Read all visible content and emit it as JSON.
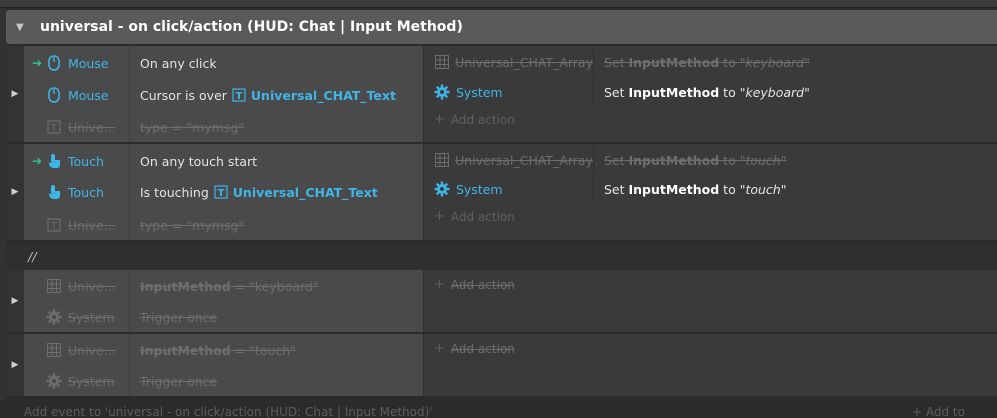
{
  "group": {
    "title": "universal - on click/action (HUD: Chat | Input Method)"
  },
  "events": [
    {
      "conditions": [
        {
          "trigger": true,
          "object": "Mouse",
          "icon": "mouse-icon",
          "text": "On any click",
          "disabled": false
        },
        {
          "trigger": false,
          "object": "Mouse",
          "icon": "mouse-icon",
          "text": "Cursor is over",
          "ref": "Universal_CHAT_Text",
          "disabled": false
        },
        {
          "trigger": false,
          "object": "Unive...",
          "icon": "text-object-icon",
          "text": "type = \"mymsg\"",
          "disabled": true
        }
      ],
      "actions": [
        {
          "object": "Universal_CHAT_Array",
          "pre": "Set ",
          "var": "InputMethod",
          "mid": " to ",
          "val": "\"keyboard\"",
          "disabled": true
        },
        {
          "object": "System",
          "pre": "Set ",
          "var": "InputMethod",
          "mid": " to ",
          "val": "\"keyboard\"",
          "disabled": false
        }
      ],
      "add_action": "Add action"
    },
    {
      "conditions": [
        {
          "trigger": true,
          "object": "Touch",
          "icon": "touch-icon",
          "text": "On any touch start",
          "disabled": false
        },
        {
          "trigger": false,
          "object": "Touch",
          "icon": "touch-icon",
          "text": "Is touching",
          "ref": "Universal_CHAT_Text",
          "disabled": false
        },
        {
          "trigger": false,
          "object": "Unive...",
          "icon": "text-object-icon",
          "text": "type = \"mymsg\"",
          "disabled": true
        }
      ],
      "actions": [
        {
          "object": "Universal_CHAT_Array",
          "pre": "Set ",
          "var": "InputMethod",
          "mid": " to ",
          "val": "\"touch\"",
          "disabled": true
        },
        {
          "object": "System",
          "pre": "Set ",
          "var": "InputMethod",
          "mid": " to ",
          "val": "\"touch\"",
          "disabled": false
        }
      ],
      "add_action": "Add action"
    }
  ],
  "comment": "//",
  "disabled_events": [
    {
      "conditions": [
        {
          "object": "Unive...",
          "icon": "array-icon",
          "text_var": "InputMethod",
          "text_rest": " = \"keyboard\""
        },
        {
          "object": "System",
          "icon": "gear-icon",
          "text": "Trigger once"
        }
      ],
      "add_action": "Add action"
    },
    {
      "conditions": [
        {
          "object": "Unive...",
          "icon": "array-icon",
          "text_var": "InputMethod",
          "text_rest": " = \"touch\""
        },
        {
          "object": "System",
          "icon": "gear-icon",
          "text": "Trigger once"
        }
      ],
      "add_action": "Add action"
    }
  ],
  "footer": {
    "add_event": "Add event to 'universal - on click/action (HUD: Chat | Input Method)'",
    "add_to": "+ Add to 'univ"
  },
  "colors": {
    "accent": "#3fb6e8",
    "trigger": "#31c48d",
    "header": "#5a5a5a"
  }
}
